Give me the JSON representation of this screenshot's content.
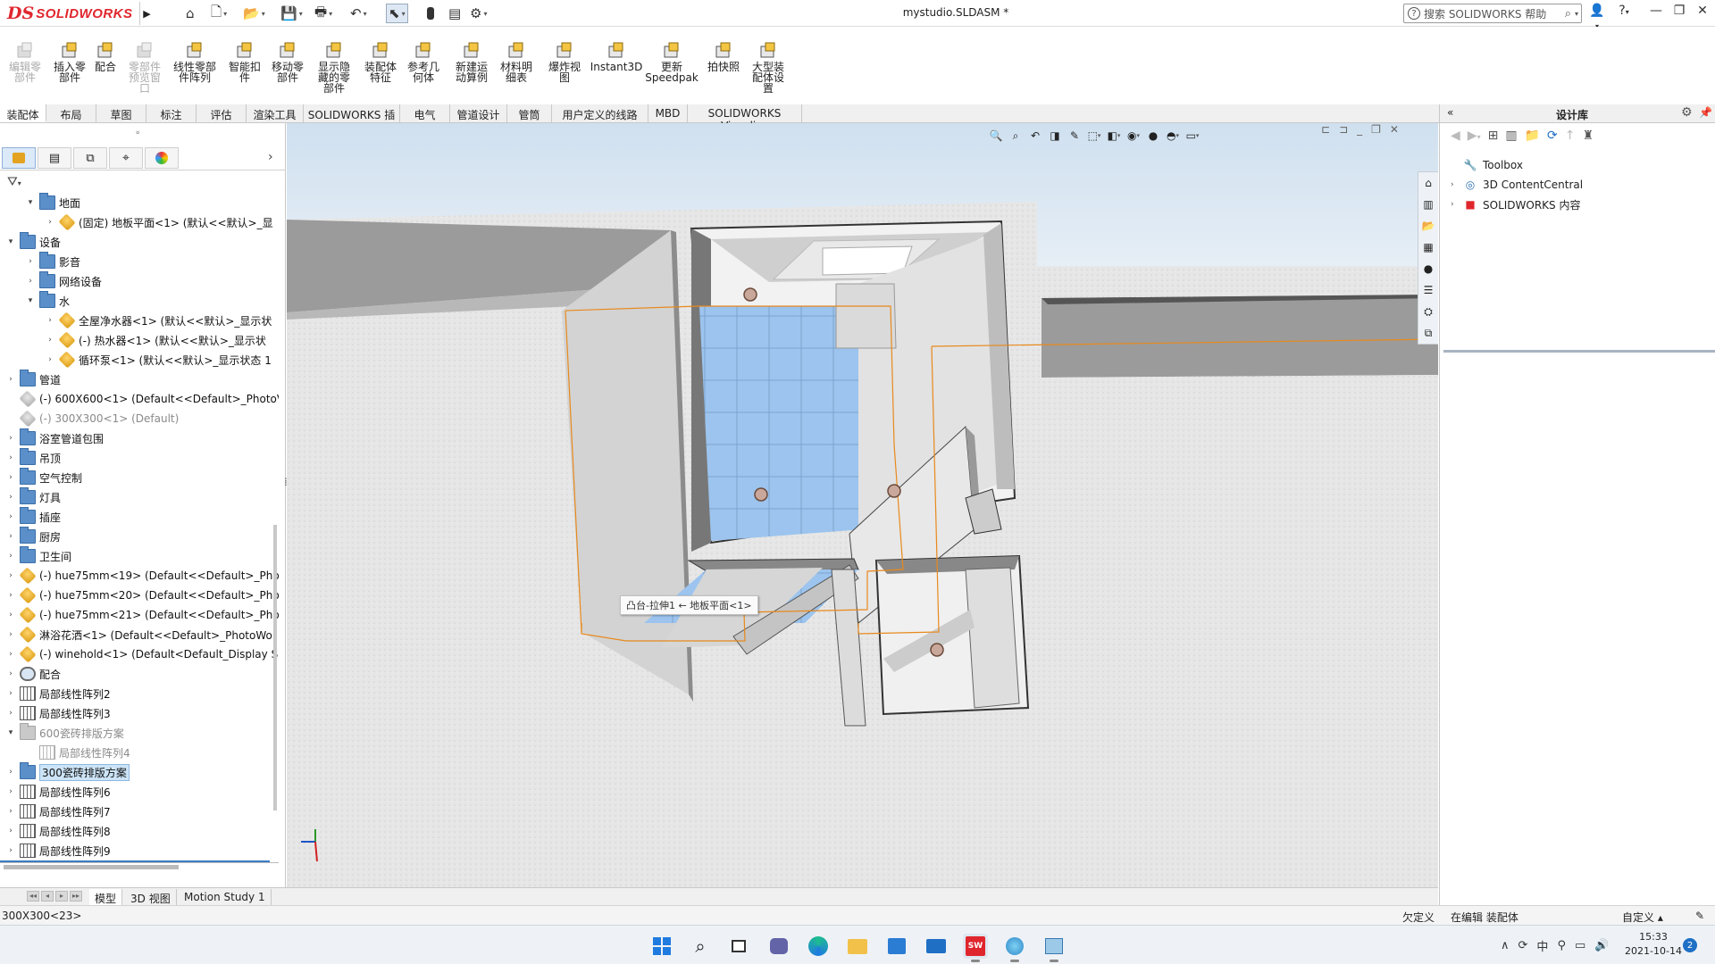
{
  "app": {
    "brand_mark": "DS",
    "brand_name": "SOLIDWORKS",
    "document_title": "mystudio.SLDASM *",
    "help_search_placeholder": "搜索 SOLIDWORKS 帮助"
  },
  "commands": [
    {
      "label": "编辑零\n部件",
      "disabled": true,
      "icon": "edit-component-icon"
    },
    {
      "label": "插入零\n部件",
      "icon": "insert-component-icon"
    },
    {
      "label": "配合",
      "icon": "mate-icon"
    },
    {
      "label": "零部件\n预览窗\n口",
      "disabled": true,
      "icon": "component-preview-icon"
    },
    {
      "label": "线性零部\n件阵列",
      "icon": "linear-pattern-icon"
    },
    {
      "label": "智能扣\n件",
      "icon": "smart-fastener-icon"
    },
    {
      "label": "移动零\n部件",
      "icon": "move-component-icon"
    },
    {
      "label": "显示隐\n藏的零\n部件",
      "icon": "show-hidden-icon"
    },
    {
      "label": "装配体\n特征",
      "icon": "assembly-features-icon"
    },
    {
      "label": "参考几\n何体",
      "icon": "reference-geometry-icon"
    },
    {
      "label": "新建运\n动算例",
      "icon": "new-motion-study-icon"
    },
    {
      "label": "材料明\n细表",
      "icon": "bom-icon"
    },
    {
      "label": "爆炸视\n图",
      "icon": "exploded-view-icon"
    },
    {
      "label": "Instant3D",
      "icon": "instant3d-icon"
    },
    {
      "label": "更新\nSpeedpak",
      "icon": "speedpak-icon"
    },
    {
      "label": "拍快照",
      "icon": "snapshot-icon"
    },
    {
      "label": "大型装\n配体设\n置",
      "icon": "large-assembly-icon"
    }
  ],
  "tabs": [
    "装配体",
    "布局",
    "草图",
    "标注",
    "评估",
    "渲染工具",
    "SOLIDWORKS 插件",
    "电气",
    "管道设计",
    "管筒",
    "用户定义的线路",
    "MBD",
    "SOLIDWORKS Visualize"
  ],
  "tree": [
    {
      "label": "地面",
      "type": "folder",
      "level": 1,
      "exp": "▾"
    },
    {
      "label": "(固定) 地板平面<1> (默认<<默认>_显",
      "type": "part",
      "level": 2,
      "exp": "›"
    },
    {
      "label": "设备",
      "type": "folder",
      "level": 0,
      "exp": "▾"
    },
    {
      "label": "影音",
      "type": "folder",
      "level": 1,
      "exp": "›"
    },
    {
      "label": "网络设备",
      "type": "folder",
      "level": 1,
      "exp": "›"
    },
    {
      "label": "水",
      "type": "folder",
      "level": 1,
      "exp": "▾"
    },
    {
      "label": "全屋净水器<1> (默认<<默认>_显示状",
      "type": "part",
      "level": 2,
      "exp": "›"
    },
    {
      "label": "(-) 热水器<1> (默认<<默认>_显示状",
      "type": "part",
      "level": 2,
      "exp": "›"
    },
    {
      "label": "循环泵<1> (默认<<默认>_显示状态 1",
      "type": "part",
      "level": 2,
      "exp": "›"
    },
    {
      "label": "管道",
      "type": "folder",
      "level": 0,
      "exp": "›"
    },
    {
      "label": "(-) 600X600<1> (Default<<Default>_PhotoV",
      "type": "part-grey-outline",
      "level": 0,
      "exp": ""
    },
    {
      "label": "(-) 300X300<1> (Default)",
      "type": "part-grey",
      "level": 0,
      "exp": "",
      "grey": true
    },
    {
      "label": "浴室管道包围",
      "type": "folder",
      "level": 0,
      "exp": "›"
    },
    {
      "label": "吊顶",
      "type": "folder",
      "level": 0,
      "exp": "›"
    },
    {
      "label": "空气控制",
      "type": "folder",
      "level": 0,
      "exp": "›"
    },
    {
      "label": "灯具",
      "type": "folder",
      "level": 0,
      "exp": "›"
    },
    {
      "label": "插座",
      "type": "folder",
      "level": 0,
      "exp": "›"
    },
    {
      "label": "厨房",
      "type": "folder",
      "level": 0,
      "exp": "›"
    },
    {
      "label": "卫生间",
      "type": "folder",
      "level": 0,
      "exp": "›"
    },
    {
      "label": "(-) hue75mm<19> (Default<<Default>_Phot",
      "type": "part",
      "level": 0,
      "exp": "›"
    },
    {
      "label": "(-) hue75mm<20> (Default<<Default>_Phot",
      "type": "part",
      "level": 0,
      "exp": "›"
    },
    {
      "label": "(-) hue75mm<21> (Default<<Default>_Phot",
      "type": "part",
      "level": 0,
      "exp": "›"
    },
    {
      "label": "淋浴花洒<1> (Default<<Default>_PhotoWor",
      "type": "part",
      "level": 0,
      "exp": "›"
    },
    {
      "label": "(-) winehold<1> (Default<Default_Display S",
      "type": "part",
      "level": 0,
      "exp": "›"
    },
    {
      "label": "配合",
      "type": "mate",
      "level": 0,
      "exp": "›"
    },
    {
      "label": "局部线性阵列2",
      "type": "pattern",
      "level": 0,
      "exp": "›"
    },
    {
      "label": "局部线性阵列3",
      "type": "pattern",
      "level": 0,
      "exp": "›"
    },
    {
      "label": "600瓷砖排版方案",
      "type": "folder-grey",
      "level": 0,
      "exp": "▾",
      "grey": true
    },
    {
      "label": "局部线性阵列4",
      "type": "pattern-grey",
      "level": 1,
      "exp": "",
      "grey": true
    },
    {
      "label": "300瓷砖排版方案",
      "type": "folder",
      "level": 0,
      "exp": "›",
      "selected": true
    },
    {
      "label": "局部线性阵列6",
      "type": "pattern",
      "level": 0,
      "exp": "›"
    },
    {
      "label": "局部线性阵列7",
      "type": "pattern",
      "level": 0,
      "exp": "›"
    },
    {
      "label": "局部线性阵列8",
      "type": "pattern",
      "level": 0,
      "exp": "›"
    },
    {
      "label": "局部线性阵列9",
      "type": "pattern",
      "level": 0,
      "exp": "›"
    }
  ],
  "bottom_tabs": [
    "模型",
    "3D 视图",
    "Motion Study 1"
  ],
  "viewport": {
    "tooltip": "凸台-拉伸1 ← 地板平面<1>"
  },
  "design_library": {
    "title": "设计库",
    "items": [
      {
        "label": "Toolbox",
        "icon": "toolbox-icon",
        "exp": ""
      },
      {
        "label": "3D ContentCentral",
        "icon": "content-central-icon",
        "exp": "›"
      },
      {
        "label": "SOLIDWORKS 内容",
        "icon": "sw-content-icon",
        "exp": "›"
      }
    ]
  },
  "status": {
    "left": "300X300<23>",
    "under_defined": "欠定义",
    "editing": "在编辑 装配体",
    "custom": "自定义"
  },
  "taskbar": {
    "ime": "中",
    "time": "15:33",
    "date": "2021-10-14",
    "notifications": "2"
  },
  "colors": {
    "brand_red": "#e0262d",
    "tile_blue": "#7fb0e6",
    "selection_orange": "#e8891c"
  }
}
